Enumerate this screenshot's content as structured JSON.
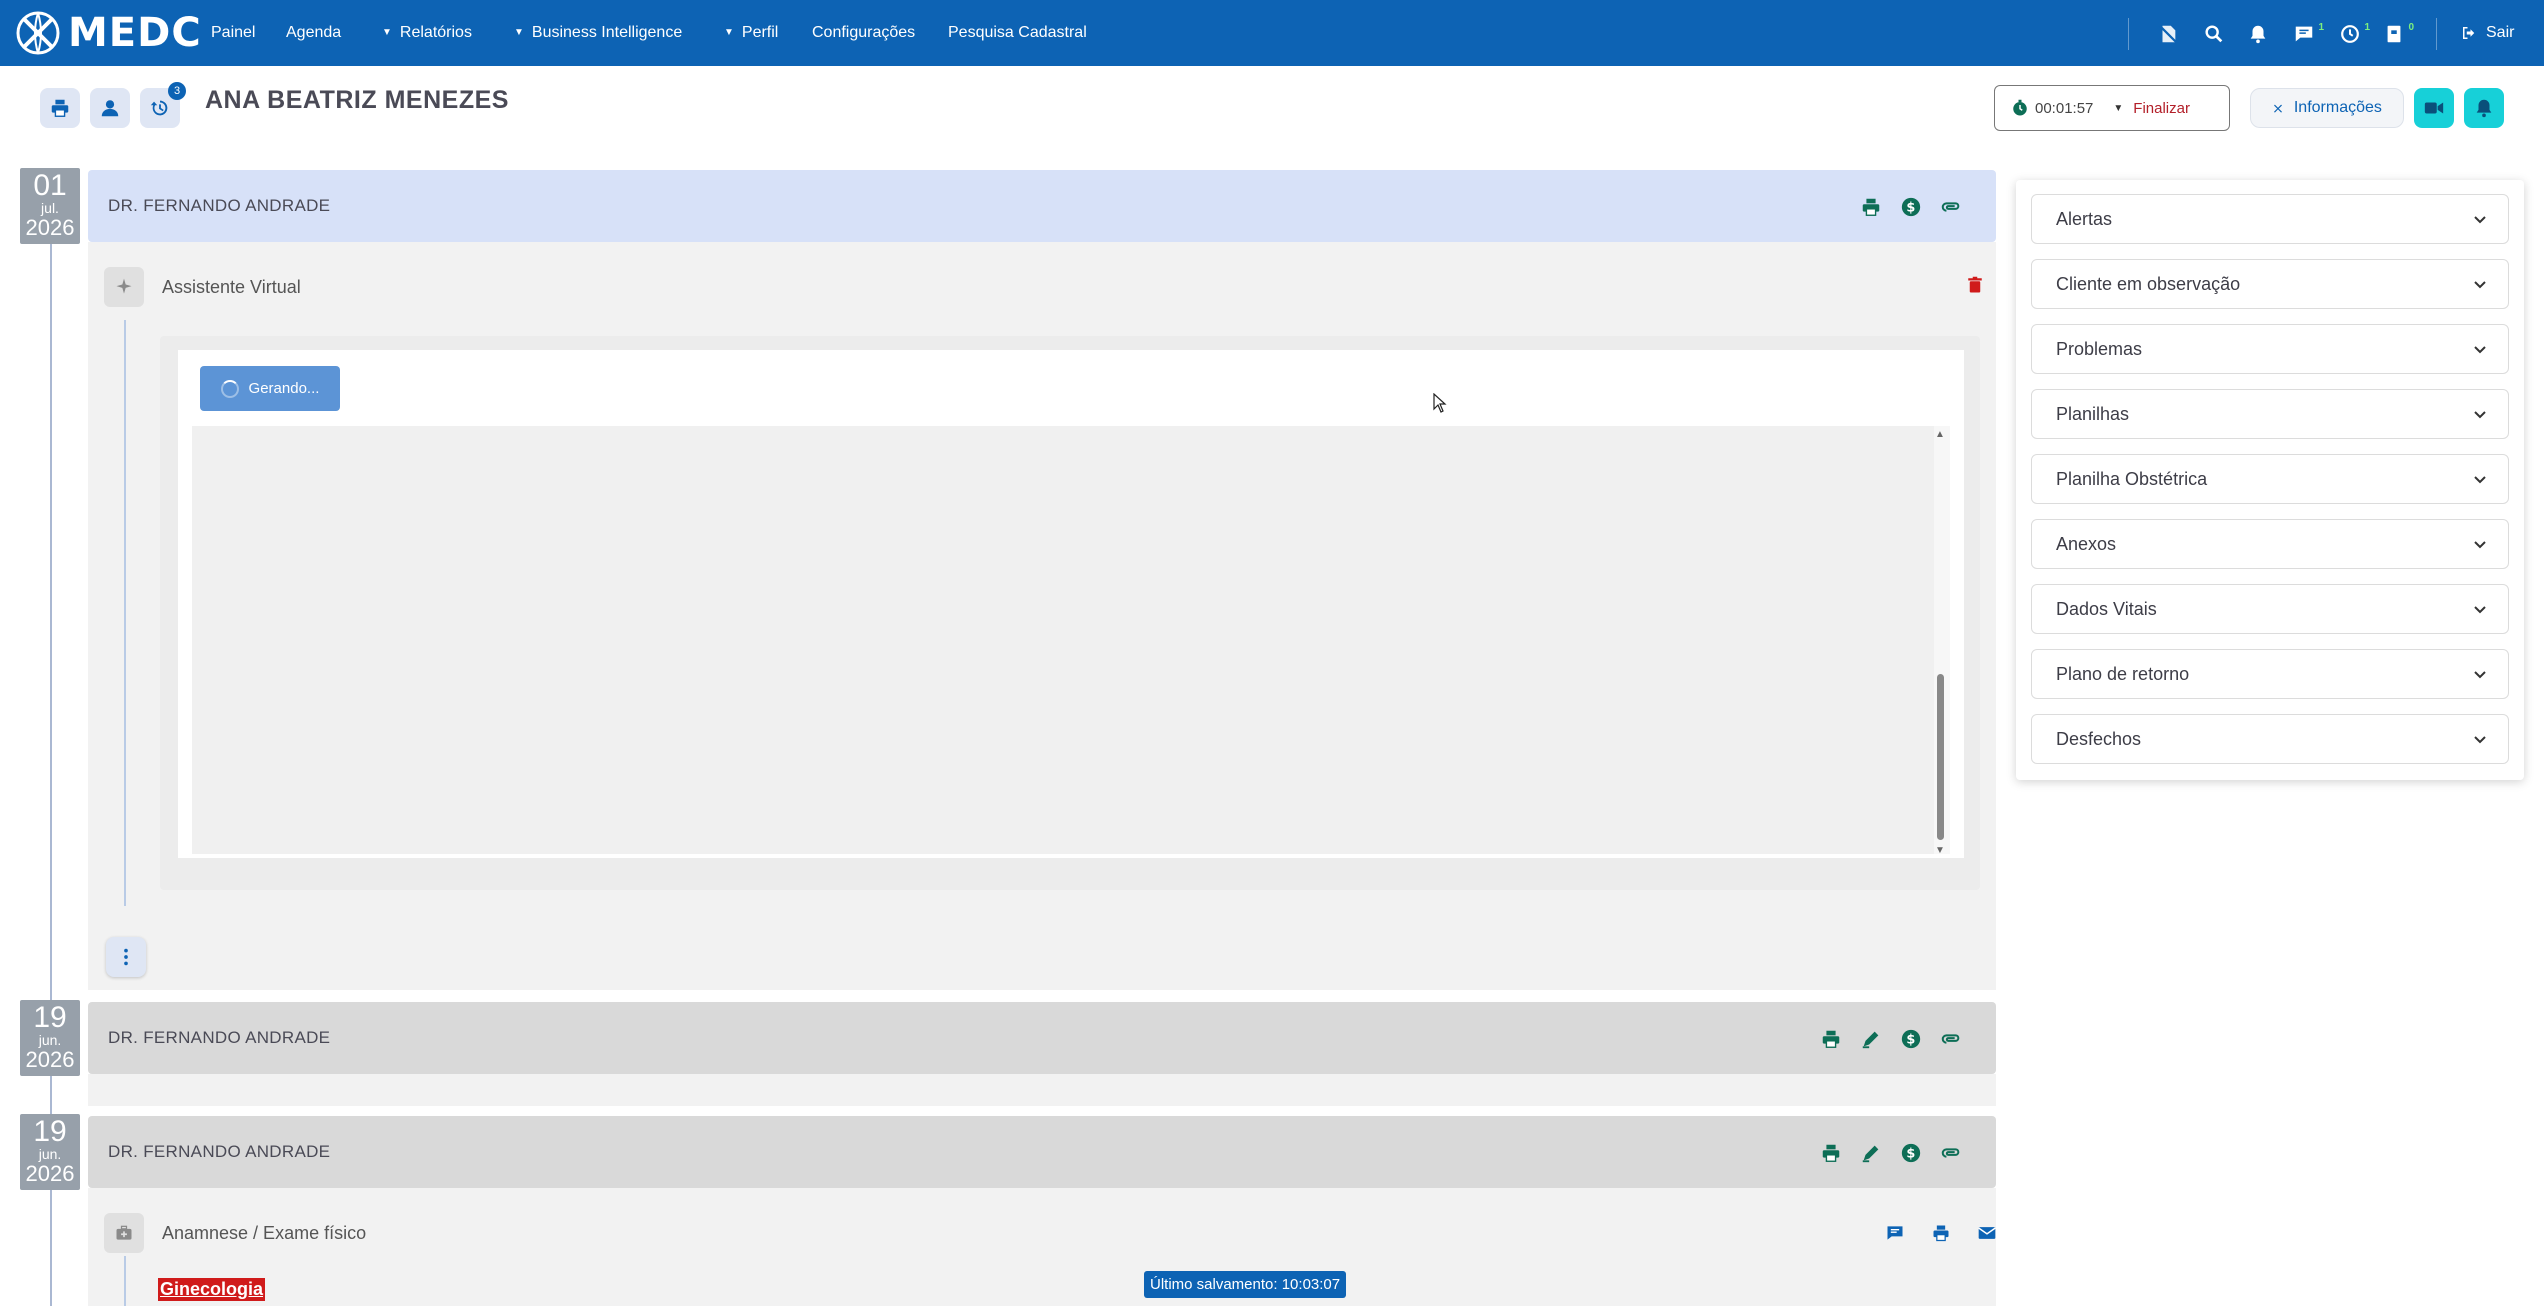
{
  "app": {
    "logo_text": "MEDC"
  },
  "nav": {
    "items": [
      {
        "label": "Painel",
        "dropdown": false
      },
      {
        "label": "Agenda",
        "dropdown": false
      },
      {
        "label": "Relatórios",
        "dropdown": true
      },
      {
        "label": "Business Intelligence",
        "dropdown": true
      },
      {
        "label": "Perfil",
        "dropdown": true
      },
      {
        "label": "Configurações",
        "dropdown": false
      },
      {
        "label": "Pesquisa Cadastral",
        "dropdown": false
      }
    ],
    "badges": {
      "messages": "1",
      "clock": "1",
      "archive": "0"
    },
    "logout_label": "Sair"
  },
  "header": {
    "patient_name": "ANA BEATRIZ MENEZES",
    "history_badge": "3",
    "timer": "00:01:57",
    "finish_label": "Finalizar",
    "info_label": "Informações"
  },
  "timeline": [
    {
      "day": "01",
      "month": "jul.",
      "year": "2026",
      "doctor": "DR. FERNANDO ANDRADE"
    },
    {
      "day": "19",
      "month": "jun.",
      "year": "2026",
      "doctor": "DR. FERNANDO ANDRADE"
    },
    {
      "day": "19",
      "month": "jun.",
      "year": "2026",
      "doctor": "DR. FERNANDO ANDRADE"
    }
  ],
  "assistant": {
    "section_title": "Assistente Virtual",
    "generating_label": "Gerando..."
  },
  "anamnese": {
    "section_title": "Anamnese / Exame físico",
    "specialty_tag": "Ginecologia",
    "last_saved": "Último salvamento: 10:03:07"
  },
  "right_panel": {
    "sections": [
      "Alertas",
      "Cliente em observação",
      "Problemas",
      "Planilhas",
      "Planilha Obstétrica",
      "Anexos",
      "Dados Vitais",
      "Plano de retorno",
      "Desfechos"
    ]
  },
  "colors": {
    "nav_bg": "#0d63b4",
    "active_consult_bg": "#d7e1f8",
    "past_consult_bg": "#d9d9d9",
    "action_icon": "#0d6e56",
    "teal": "#17d0d8",
    "danger": "#d01b1b"
  }
}
